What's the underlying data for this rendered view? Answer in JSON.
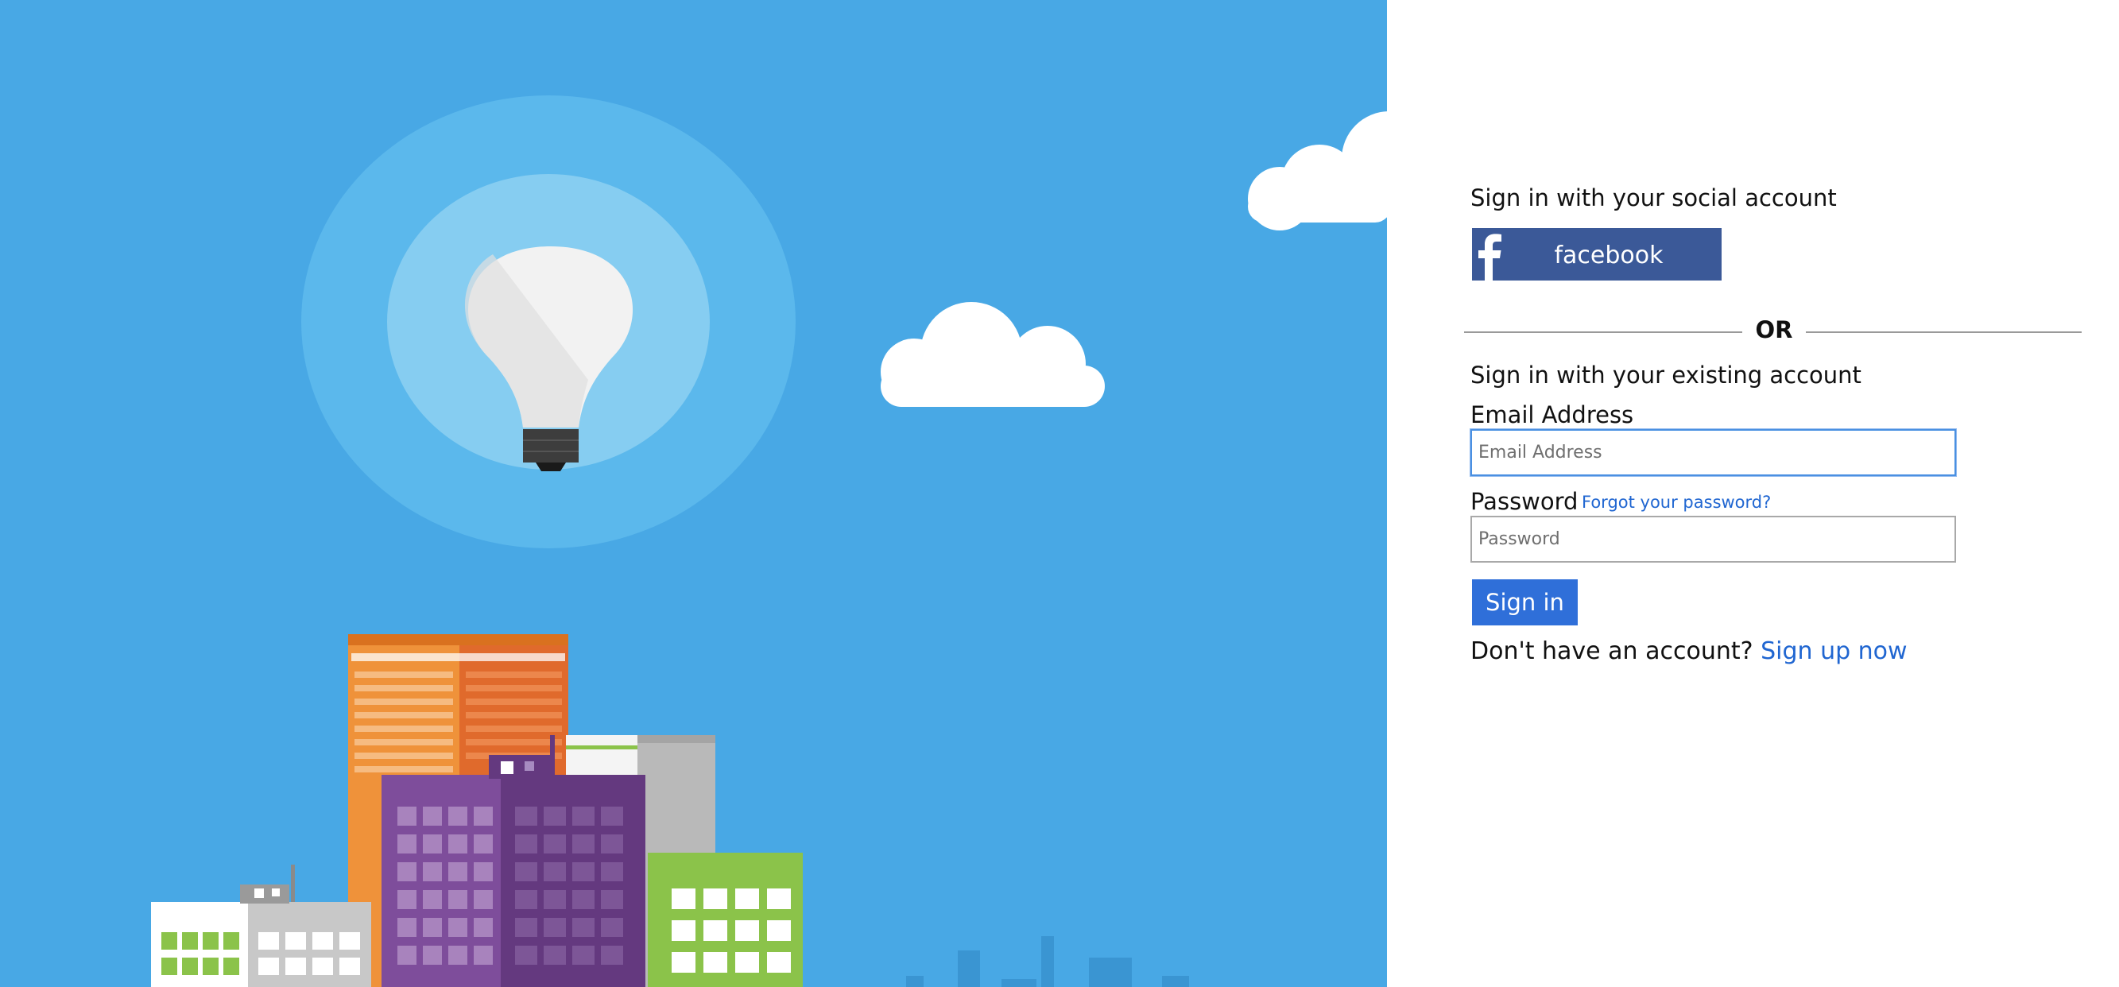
{
  "colors": {
    "hero_background": "#48a8e5",
    "facebook_blue": "#3b5998",
    "primary_button": "#2f6fd9",
    "link": "#2066d1"
  },
  "illustration": {
    "icons": [
      "lightbulb-icon",
      "cloud-icon",
      "city-skyline-icon"
    ]
  },
  "social": {
    "heading": "Sign in with your social account",
    "facebook_button_label": "facebook",
    "facebook_icon": "facebook-f-icon"
  },
  "divider": {
    "text": "OR"
  },
  "local": {
    "heading": "Sign in with your existing account",
    "email_label": "Email Address",
    "email_placeholder": "Email Address",
    "email_value": "",
    "password_label": "Password",
    "forgot_password_link": "Forgot your password?",
    "password_placeholder": "Password",
    "password_value": "",
    "signin_button": "Sign in"
  },
  "signup": {
    "prompt": "Don't have an account?",
    "link": "Sign up now"
  }
}
